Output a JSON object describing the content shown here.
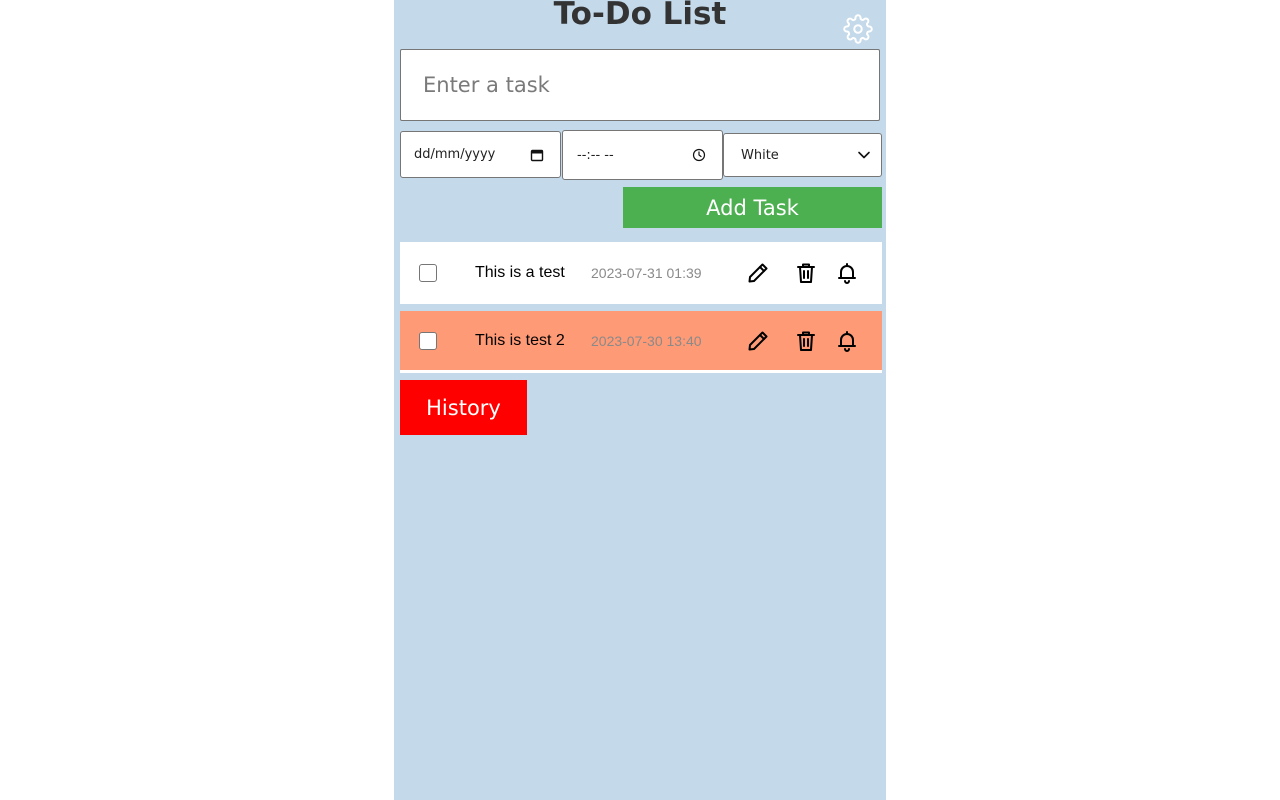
{
  "app": {
    "title": "To-Do List",
    "background_color": "#c4d9e9"
  },
  "form": {
    "task_placeholder": "Enter a task",
    "task_value": "",
    "date_placeholder": "dd/mm/yyyy",
    "time_placeholder": "--:-- --",
    "color_selected": "White",
    "add_button_label": "Add Task",
    "add_button_color": "#4caf50"
  },
  "tasks": [
    {
      "text": "This is a test",
      "datetime": "2023-07-31 01:39",
      "completed": false,
      "color": "#ffffff"
    },
    {
      "text": "This is test 2",
      "datetime": "2023-07-30 13:40",
      "completed": false,
      "color": "#ff9a76"
    }
  ],
  "history": {
    "label": "History",
    "color": "#ff0000"
  },
  "icons": {
    "settings": "gear-icon",
    "edit": "pencil-icon",
    "delete": "trash-icon",
    "reminder": "bell-icon",
    "calendar": "calendar-icon",
    "clock": "clock-icon",
    "dropdown": "chevron-down-icon"
  }
}
